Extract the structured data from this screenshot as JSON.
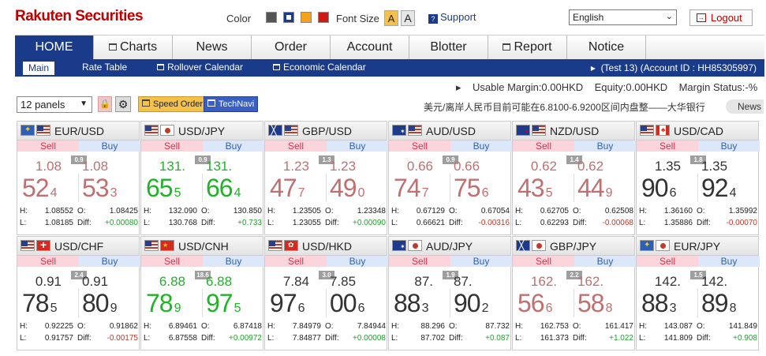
{
  "header": {
    "logo": "Rakuten Securities",
    "color_label": "Color",
    "font_size_label": "Font Size",
    "font_a1": "A",
    "font_a2": "A",
    "support": "Support",
    "language": "English",
    "logout": "Logout",
    "swatches": [
      "#555555",
      "#1a3a8a",
      "#f4a21a",
      "#cc1a1a"
    ]
  },
  "nav": {
    "tabs": [
      "HOME",
      "Charts",
      "News",
      "Order",
      "Account",
      "Blotter",
      "Report",
      "Notice"
    ]
  },
  "subnav": {
    "items": [
      "Main",
      "Rate Table",
      "Rollover Calendar",
      "Economic Calendar"
    ],
    "account": "(Test 13) (Account ID : HH85305997)"
  },
  "margin_bar": {
    "usable": "Usable Margin:0.00HKD",
    "equity": "Equity:0.00HKD",
    "status": "Margin Status:-%"
  },
  "toolbar": {
    "panels": "12 panels",
    "speed_order": "Speed Order",
    "technavi": "TechNavi",
    "news_text": "美元/离岸人民币目前可能在6.8100-6.9200区间内盘整——大华银行",
    "news_label": "News"
  },
  "labels": {
    "sell": "Sell",
    "buy": "Buy",
    "h": "H:",
    "l": "L:",
    "o": "O:",
    "diff": "Diff:"
  },
  "panels": [
    {
      "pair": "EUR/USD",
      "flags": [
        "eu",
        "us"
      ],
      "spread": "0.9",
      "color": "red",
      "sell_small": "1.08",
      "sell_big": "52",
      "sell_pip": "4",
      "buy_small": "1.08",
      "buy_big": "53",
      "buy_pip": "3",
      "high": "1.08552",
      "low": "1.08185",
      "open": "1.08425",
      "diff": "+0.00080",
      "diff_sign": "pos"
    },
    {
      "pair": "USD/JPY",
      "flags": [
        "us",
        "jp"
      ],
      "spread": "0.9",
      "color": "green",
      "sell_small": "131.",
      "sell_big": "65",
      "sell_pip": "5",
      "buy_small": "131.",
      "buy_big": "66",
      "buy_pip": "4",
      "high": "132.090",
      "low": "130.768",
      "open": "130.850",
      "diff": "+0.733",
      "diff_sign": "pos"
    },
    {
      "pair": "GBP/USD",
      "flags": [
        "gb",
        "us"
      ],
      "spread": "1.3",
      "color": "red",
      "sell_small": "1.23",
      "sell_big": "47",
      "sell_pip": "7",
      "buy_small": "1.23",
      "buy_big": "49",
      "buy_pip": "0",
      "high": "1.23505",
      "low": "1.23055",
      "open": "1.23348",
      "diff": "+0.00090",
      "diff_sign": "pos"
    },
    {
      "pair": "AUD/USD",
      "flags": [
        "au",
        "us"
      ],
      "spread": "0.9",
      "color": "red",
      "sell_small": "0.66",
      "sell_big": "74",
      "sell_pip": "7",
      "buy_small": "0.66",
      "buy_big": "75",
      "buy_pip": "6",
      "high": "0.67129",
      "low": "0.66621",
      "open": "0.67054",
      "diff": "-0.00316",
      "diff_sign": "neg"
    },
    {
      "pair": "NZD/USD",
      "flags": [
        "nz",
        "us"
      ],
      "spread": "1.4",
      "color": "red",
      "sell_small": "0.62",
      "sell_big": "43",
      "sell_pip": "5",
      "buy_small": "0.62",
      "buy_big": "44",
      "buy_pip": "9",
      "high": "0.62705",
      "low": "0.62293",
      "open": "0.62508",
      "diff": "-0.00068",
      "diff_sign": "neg"
    },
    {
      "pair": "USD/CAD",
      "flags": [
        "us",
        "ca"
      ],
      "spread": "1.8",
      "color": "dark",
      "sell_small": "1.35",
      "sell_big": "90",
      "sell_pip": "6",
      "buy_small": "1.35",
      "buy_big": "92",
      "buy_pip": "4",
      "high": "1.36160",
      "low": "1.35886",
      "open": "1.35992",
      "diff": "-0.00070",
      "diff_sign": "neg"
    },
    {
      "pair": "USD/CHF",
      "flags": [
        "us",
        "ch"
      ],
      "spread": "2.4",
      "color": "dark",
      "sell_small": "0.91",
      "sell_big": "78",
      "sell_pip": "5",
      "buy_small": "0.91",
      "buy_big": "80",
      "buy_pip": "9",
      "high": "0.92225",
      "low": "0.91757",
      "open": "0.91862",
      "diff": "-0.00175",
      "diff_sign": "neg"
    },
    {
      "pair": "USD/CNH",
      "flags": [
        "us",
        "cn"
      ],
      "spread": "18.6",
      "color": "green",
      "sell_small": "6.88",
      "sell_big": "78",
      "sell_pip": "9",
      "buy_small": "6.88",
      "buy_big": "97",
      "buy_pip": "5",
      "high": "6.89461",
      "low": "6.87558",
      "open": "6.87418",
      "diff": "+0.00972",
      "diff_sign": "pos"
    },
    {
      "pair": "USD/HKD",
      "flags": [
        "us",
        "hk"
      ],
      "spread": "3.0",
      "color": "dark",
      "sell_small": "7.84",
      "sell_big": "97",
      "sell_pip": "6",
      "buy_small": "7.85",
      "buy_big": "00",
      "buy_pip": "6",
      "high": "7.84979",
      "low": "7.84877",
      "open": "7.84944",
      "diff": "+0.00008",
      "diff_sign": "pos"
    },
    {
      "pair": "AUD/JPY",
      "flags": [
        "au",
        "jp"
      ],
      "spread": "1.9",
      "color": "dark",
      "sell_small": "87.",
      "sell_big": "88",
      "sell_pip": "3",
      "buy_small": "87.",
      "buy_big": "90",
      "buy_pip": "2",
      "high": "88.296",
      "low": "87.702",
      "open": "87.732",
      "diff": "+0.087",
      "diff_sign": "pos"
    },
    {
      "pair": "GBP/JPY",
      "flags": [
        "gb",
        "jp"
      ],
      "spread": "2.2",
      "color": "red",
      "sell_small": "162.",
      "sell_big": "56",
      "sell_pip": "6",
      "buy_small": "162.",
      "buy_big": "58",
      "buy_pip": "8",
      "high": "162.753",
      "low": "161.373",
      "open": "161.417",
      "diff": "+1.022",
      "diff_sign": "pos"
    },
    {
      "pair": "EUR/JPY",
      "flags": [
        "eu",
        "jp"
      ],
      "spread": "1.5",
      "color": "dark",
      "sell_small": "142.",
      "sell_big": "88",
      "sell_pip": "3",
      "buy_small": "142.",
      "buy_big": "89",
      "buy_pip": "8",
      "high": "143.087",
      "low": "141.809",
      "open": "141.849",
      "diff": "+0.908",
      "diff_sign": "pos"
    }
  ]
}
